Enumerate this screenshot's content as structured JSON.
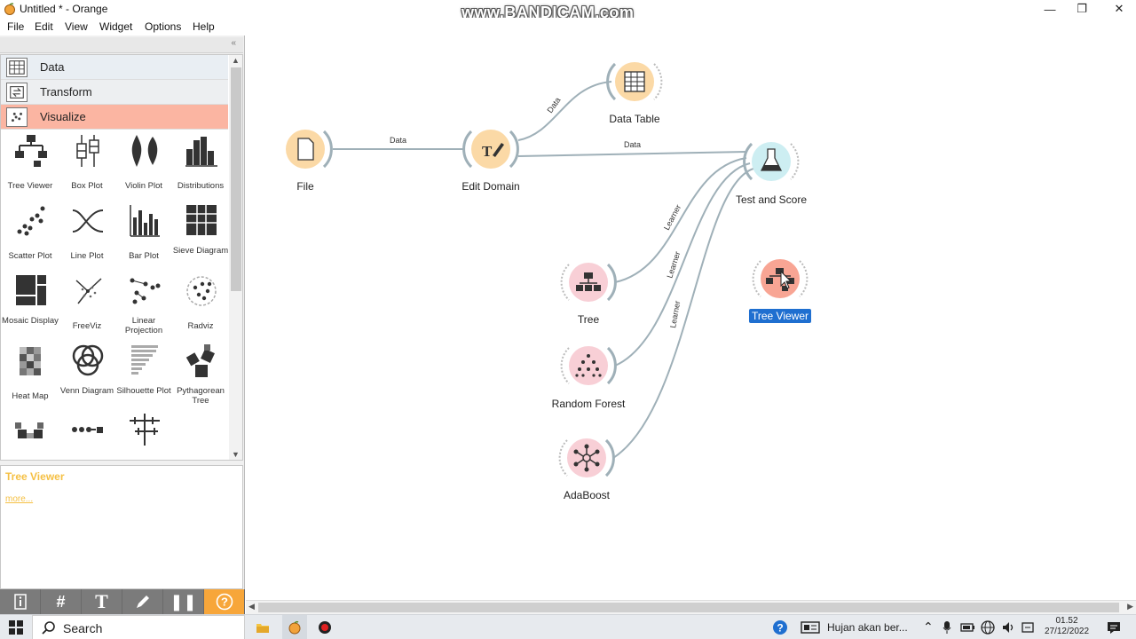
{
  "window": {
    "title": "Untitled * - Orange",
    "watermark": "www.BANDICAM.com"
  },
  "menu": [
    "File",
    "Edit",
    "View",
    "Widget",
    "Options",
    "Help"
  ],
  "categories": [
    "Data",
    "Transform",
    "Visualize"
  ],
  "widgets": [
    {
      "label": "Tree Viewer",
      "icon": "tree-viewer-icon"
    },
    {
      "label": "Box Plot",
      "icon": "box-plot-icon"
    },
    {
      "label": "Violin Plot",
      "icon": "violin-plot-icon"
    },
    {
      "label": "Distributions",
      "icon": "distributions-icon"
    },
    {
      "label": "Scatter Plot",
      "icon": "scatter-plot-icon"
    },
    {
      "label": "Line Plot",
      "icon": "line-plot-icon"
    },
    {
      "label": "Bar Plot",
      "icon": "bar-plot-icon"
    },
    {
      "label": "Sieve Diagram",
      "icon": "sieve-diagram-icon"
    },
    {
      "label": "Mosaic Display",
      "icon": "mosaic-display-icon"
    },
    {
      "label": "FreeViz",
      "icon": "freeviz-icon"
    },
    {
      "label": "Linear Projection",
      "icon": "linear-projection-icon"
    },
    {
      "label": "Radviz",
      "icon": "radviz-icon"
    },
    {
      "label": "Heat Map",
      "icon": "heat-map-icon"
    },
    {
      "label": "Venn Diagram",
      "icon": "venn-diagram-icon"
    },
    {
      "label": "Silhouette Plot",
      "icon": "silhouette-plot-icon"
    },
    {
      "label": "Pythagorean Tree",
      "icon": "pythagorean-tree-icon"
    },
    {
      "label": "",
      "icon": "pythagorean-forest-icon"
    },
    {
      "label": "",
      "icon": "cn2-rule-viewer-icon"
    },
    {
      "label": "",
      "icon": "nomogram-icon"
    }
  ],
  "description": {
    "title": "Tree Viewer",
    "more": "more..."
  },
  "nodes": {
    "file": {
      "label": "File",
      "color": "#fbd9a6"
    },
    "edit_domain": {
      "label": "Edit Domain",
      "color": "#fbd9a6"
    },
    "data_table": {
      "label": "Data Table",
      "color": "#fbd9a6"
    },
    "test_and_score": {
      "label": "Test and Score",
      "color": "#cdeef2"
    },
    "tree": {
      "label": "Tree",
      "color": "#f8cfd6"
    },
    "random_forest": {
      "label": "Random Forest",
      "color": "#f8cfd6"
    },
    "adaboost": {
      "label": "AdaBoost",
      "color": "#f8cfd6"
    },
    "tree_viewer": {
      "label": "Tree Viewer",
      "color": "#f8a594"
    }
  },
  "links": {
    "file_edit": "Data",
    "edit_table": "Data",
    "edit_test": "Data",
    "tree_test": "Learner",
    "forest_test": "Learner",
    "ada_test": "Learner"
  },
  "taskbar": {
    "search": "Search",
    "notification": "Hujan akan ber...",
    "time": "01.52",
    "date": "27/12/2022"
  }
}
